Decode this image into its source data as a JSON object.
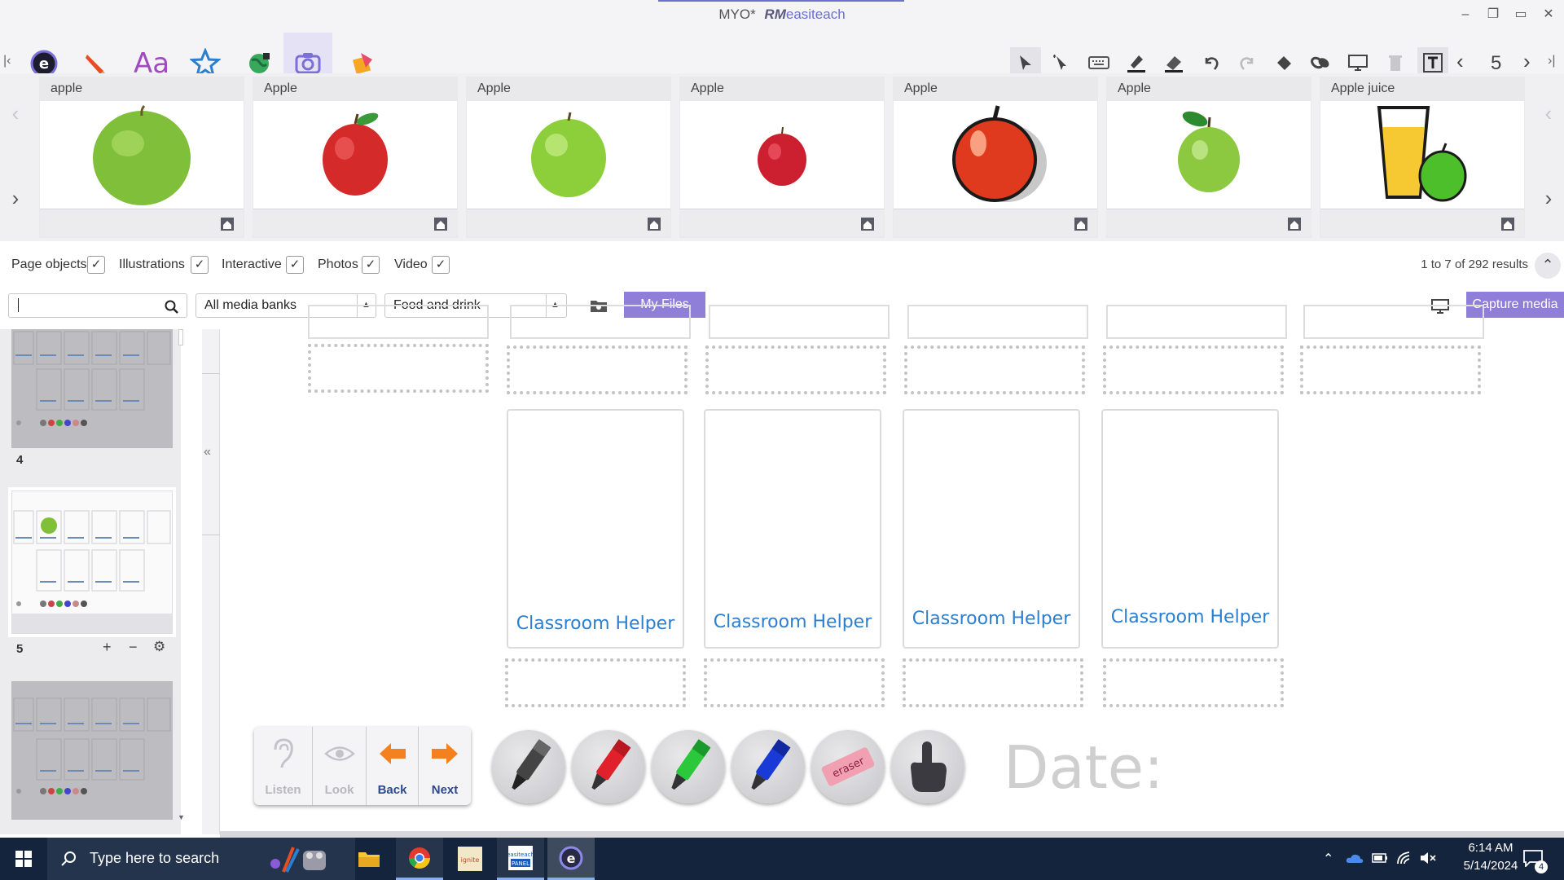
{
  "window": {
    "title_doc": "MYO*",
    "title_brand": "RM",
    "title_brand_suffix": "easiteach"
  },
  "toolbar": {
    "left_tools": [
      "easiteach-logo-icon",
      "pen-icon",
      "text-icon",
      "star-icon",
      "globe-icon",
      "camera-icon",
      "shapes-icon"
    ],
    "right_tools": [
      "select-icon",
      "magic-wand-icon",
      "keyboard-icon",
      "highlighter-icon",
      "eraser-icon",
      "undo-icon",
      "redo-icon",
      "fill-icon",
      "link-icon",
      "screen-icon",
      "trash-icon",
      "text-box-icon"
    ],
    "page_number": "5"
  },
  "media": {
    "items": [
      {
        "label": "apple",
        "kind": "green-apple"
      },
      {
        "label": "Apple",
        "kind": "red-apple"
      },
      {
        "label": "Apple",
        "kind": "green-apple"
      },
      {
        "label": "Apple",
        "kind": "small-red-apple"
      },
      {
        "label": "Apple",
        "kind": "cartoon-apple"
      },
      {
        "label": "Apple",
        "kind": "green-apple-leaf"
      },
      {
        "label": "Apple juice",
        "kind": "apple-juice"
      }
    ],
    "results": "1 to 7 of 292 results"
  },
  "filters": {
    "page_objects": "Page objects",
    "illustrations": "Illustrations",
    "interactive": "Interactive",
    "photos": "Photos",
    "video": "Video",
    "checkmark": "✓"
  },
  "search": {
    "value": "",
    "media_bank": "All media banks",
    "category": "Food and drink",
    "my_files": "My Files",
    "capture_media": "Capture media"
  },
  "pages": {
    "items": [
      {
        "number": "4"
      },
      {
        "number": "5"
      },
      {
        "number": ""
      }
    ],
    "add": "+",
    "remove": "−",
    "settings": "⚙",
    "collapse": "«"
  },
  "canvas": {
    "helper_label": "Classroom Helper",
    "date_label": "Date:"
  },
  "navtools": {
    "listen": "Listen",
    "look": "Look",
    "back": "Back",
    "next": "Next",
    "eraser": "eraser"
  },
  "taskbar": {
    "search_placeholder": "Type here to search",
    "time": "6:14 AM",
    "date": "5/14/2024",
    "notifications": "4"
  }
}
